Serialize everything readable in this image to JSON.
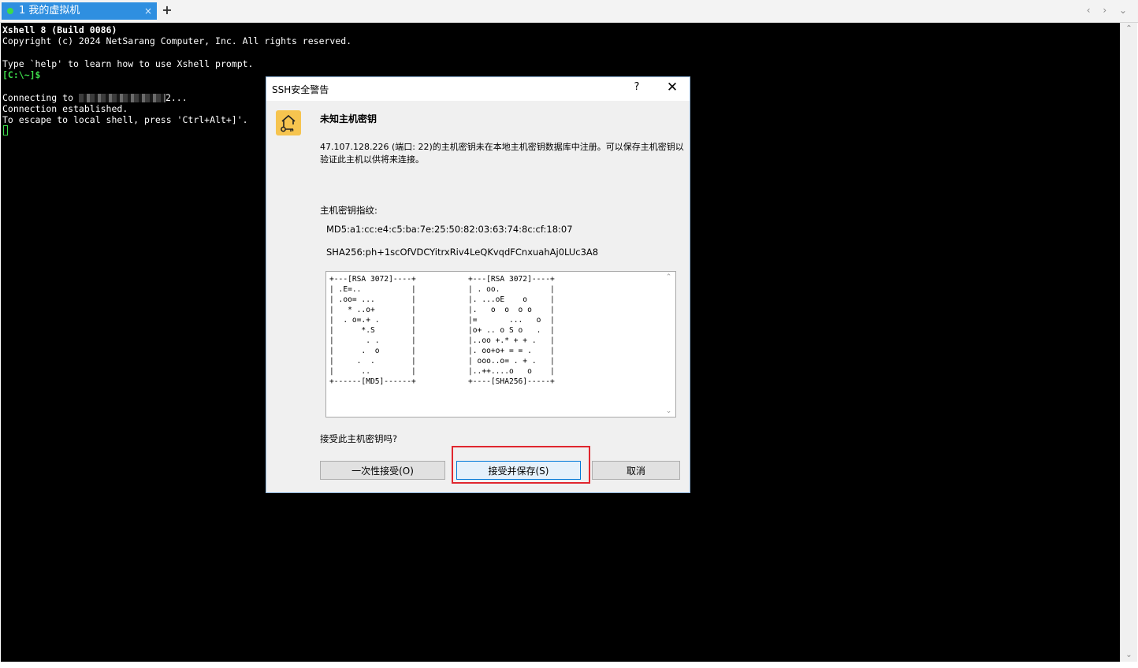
{
  "tabbar": {
    "tab_label": "1 我的虚拟机",
    "tab_close": "×",
    "add": "+",
    "nav": "‹ › ⌄"
  },
  "terminal": {
    "lines": [
      "Xshell 8 (Build 0086)",
      "Copyright (c) 2024 NetSarang Computer, Inc. All rights reserved.",
      "Type `help' to learn how to use Xshell prompt.",
      "[C:\\~]$",
      "Connecting to",
      "2...",
      "Connection established.",
      "To escape to local shell, press 'Ctrl+Alt+]'."
    ]
  },
  "dialog": {
    "title": "SSH安全警告",
    "help": "?",
    "close": "✕",
    "heading": "未知主机密钥",
    "message": "47.107.128.226 (端口: 22)的主机密钥未在本地主机密钥数据库中注册。可以保存主机密钥以验证此主机以供将来连接。",
    "fingerprint_label": "主机密钥指纹:",
    "md5": "MD5:a1:cc:e4:c5:ba:7e:25:50:82:03:63:74:8c:cf:18:07",
    "sha256": "SHA256:ph+1scOfVDCYitrxRiv4LeQKvqdFCnxuahAj0LUc3A8",
    "art_md5": "+---[RSA 3072]----+\n| .E=..           |\n| .oo= ...        |\n|   * ..o+        |\n|  . o=.+ .       |\n|      *.S        |\n|       . .       |\n|      .  o       |\n|     .  .        |\n|      ..         |\n+------[MD5]------+",
    "art_sha256": "+---[RSA 3072]----+\n| . oo.           |\n|. ...oE    o     |\n|.   o  o  o o    |\n|=       ...   o  |\n|o+ .. o S o   .  |\n|..oo +.* + + .   |\n|. oo+o+ = = .    |\n| ooo..o= . + .   |\n|..++....o   o    |\n+----[SHA256]-----+",
    "question": "接受此主机密钥吗?",
    "btn_once": "一次性接受(O)",
    "btn_save": "接受并保存(S)",
    "btn_cancel": "取消"
  },
  "colors": {
    "tab_active": "#2f8fe0",
    "prompt_green": "#3ddc4a",
    "highlight_red": "#e0262e",
    "key_icon": "#f6c44f"
  }
}
